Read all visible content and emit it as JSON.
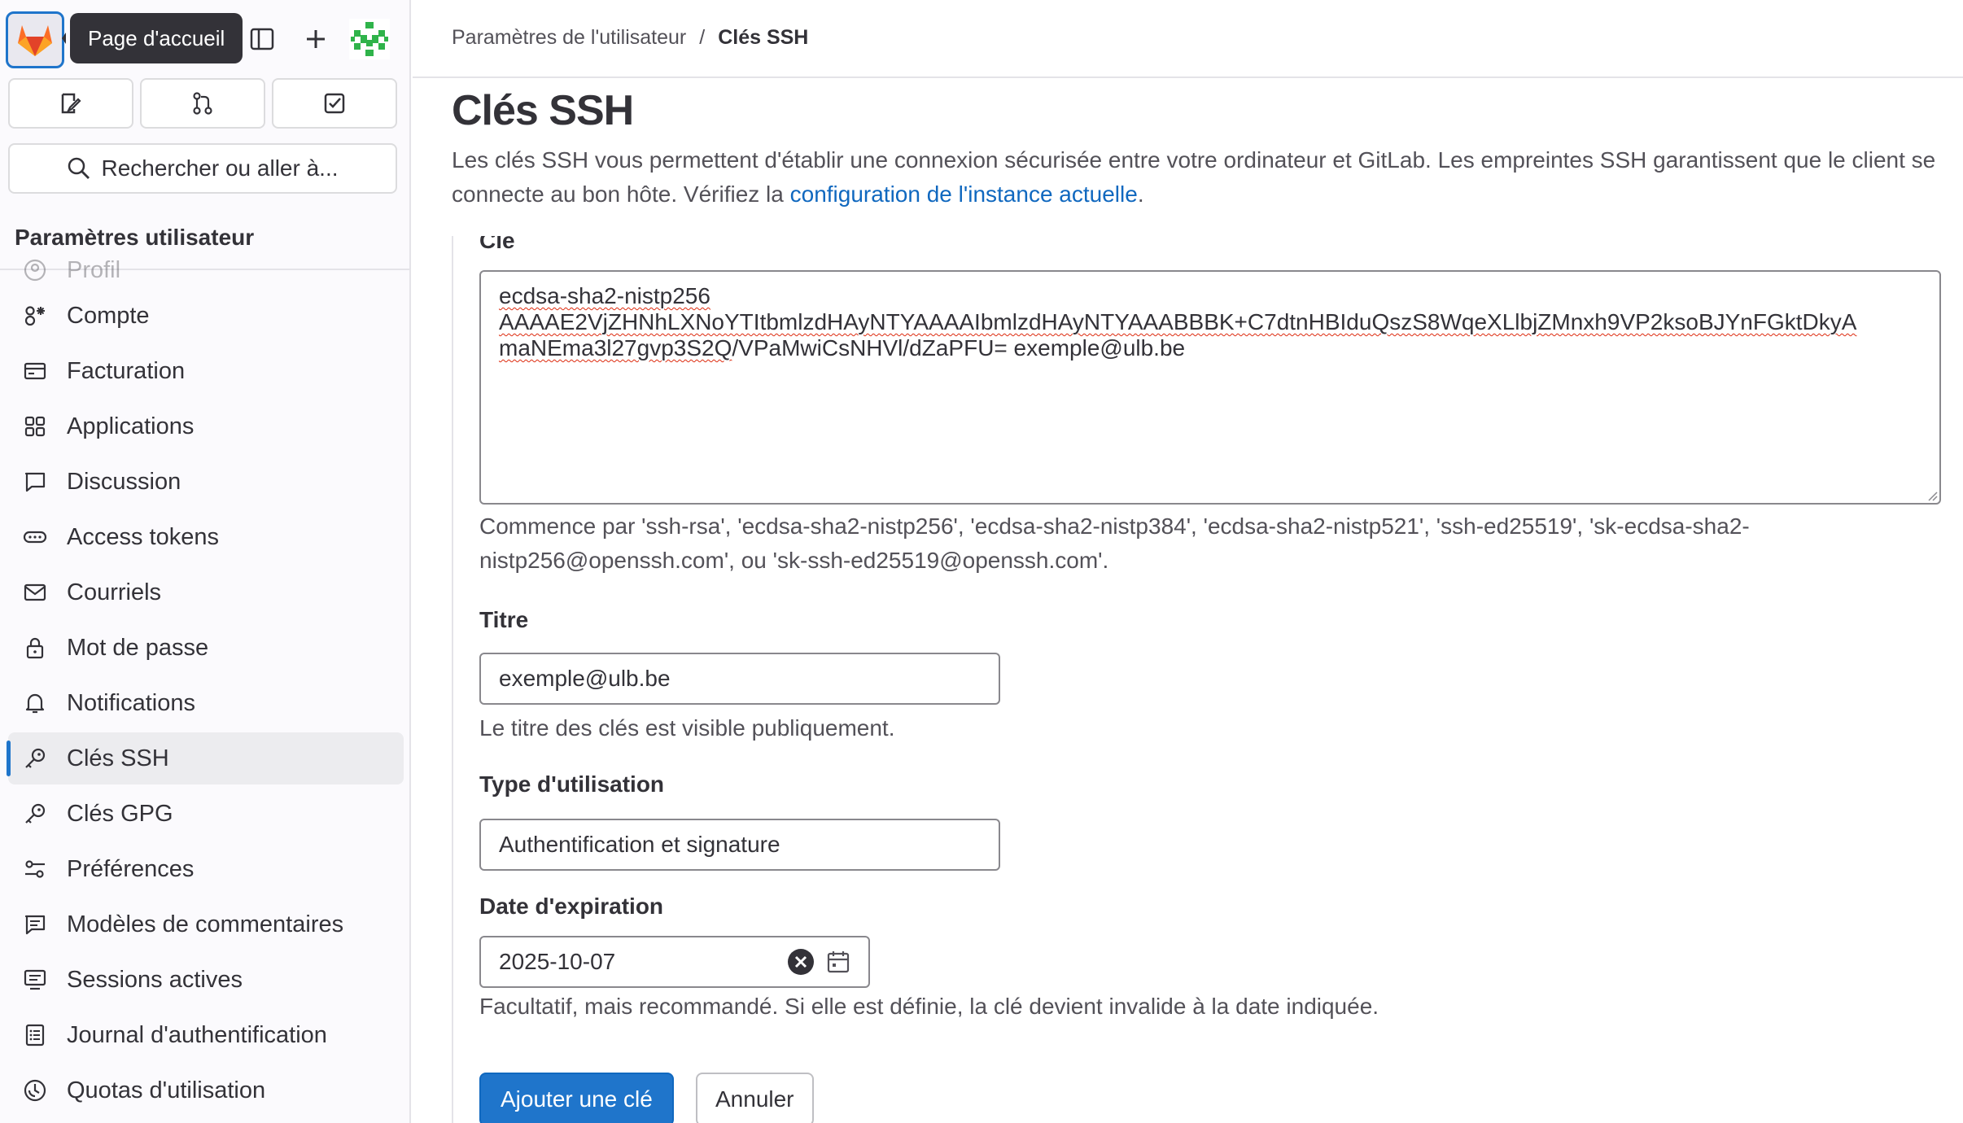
{
  "topbar": {
    "tooltip": "Page d'accueil",
    "search_label": "Rechercher ou aller à..."
  },
  "sidebar": {
    "title": "Paramètres utilisateur",
    "items": [
      {
        "label": "Profil",
        "icon": "profile-icon"
      },
      {
        "label": "Compte",
        "icon": "account-icon"
      },
      {
        "label": "Facturation",
        "icon": "billing-icon"
      },
      {
        "label": "Applications",
        "icon": "applications-icon"
      },
      {
        "label": "Discussion",
        "icon": "chat-icon"
      },
      {
        "label": "Access tokens",
        "icon": "token-icon"
      },
      {
        "label": "Courriels",
        "icon": "mail-icon"
      },
      {
        "label": "Mot de passe",
        "icon": "lock-icon"
      },
      {
        "label": "Notifications",
        "icon": "bell-icon"
      },
      {
        "label": "Clés SSH",
        "icon": "key-icon",
        "active": true
      },
      {
        "label": "Clés GPG",
        "icon": "key-icon"
      },
      {
        "label": "Préférences",
        "icon": "preferences-icon"
      },
      {
        "label": "Modèles de commentaires",
        "icon": "comment-template-icon"
      },
      {
        "label": "Sessions actives",
        "icon": "monitor-icon"
      },
      {
        "label": "Journal d'authentification",
        "icon": "log-icon"
      },
      {
        "label": "Quotas d'utilisation",
        "icon": "quota-icon"
      }
    ]
  },
  "breadcrumb": {
    "parent": "Paramètres de l'utilisateur",
    "separator": "/",
    "current": "Clés SSH"
  },
  "page": {
    "title": "Clés SSH",
    "description": "Les clés SSH vous permettent d'établir une connexion sécurisée entre votre ordinateur et GitLab. Les empreintes SSH garantissent que le client se connecte au bon hôte. Vérifiez la",
    "link_text": "configuration de l'instance actuelle",
    "link_suffix": "."
  },
  "form": {
    "key_label": "Clé",
    "key_line1": "ecdsa-sha2-nistp256",
    "key_line2": "AAAAE2VjZHNhLXNoYTItbmlzdHAyNTYAAAAIbmlzdHAyNTYAAABBBK+C7dtnHBIduQszS8WqeXLlbjZMnxh9VP2ksoBJYnFGktDkyA",
    "key_line3a": "maNEma3l27gvp3S2Q",
    "key_line3b": "/VPaMwiCsNHVl/dZaPFU= exemple@ulb.be",
    "key_help": "Commence par 'ssh-rsa', 'ecdsa-sha2-nistp256', 'ecdsa-sha2-nistp384', 'ecdsa-sha2-nistp521', 'ssh-ed25519', 'sk-ecdsa-sha2-nistp256@openssh.com', ou 'sk-ssh-ed25519@openssh.com'.",
    "title_label": "Titre",
    "title_value": "exemple@ulb.be",
    "title_help": "Le titre des clés est visible publiquement.",
    "usage_label": "Type d'utilisation",
    "usage_value": "Authentification et signature",
    "expiry_label": "Date d'expiration",
    "expiry_value": "2025-10-07",
    "expiry_help": "Facultatif, mais recommandé. Si elle est définie, la clé devient invalide à la date indiquée.",
    "submit_label": "Ajouter une clé",
    "cancel_label": "Annuler"
  },
  "colors": {
    "accent": "#1f75cb",
    "link": "#1068bf",
    "text": "#333238",
    "muted": "#535158"
  }
}
